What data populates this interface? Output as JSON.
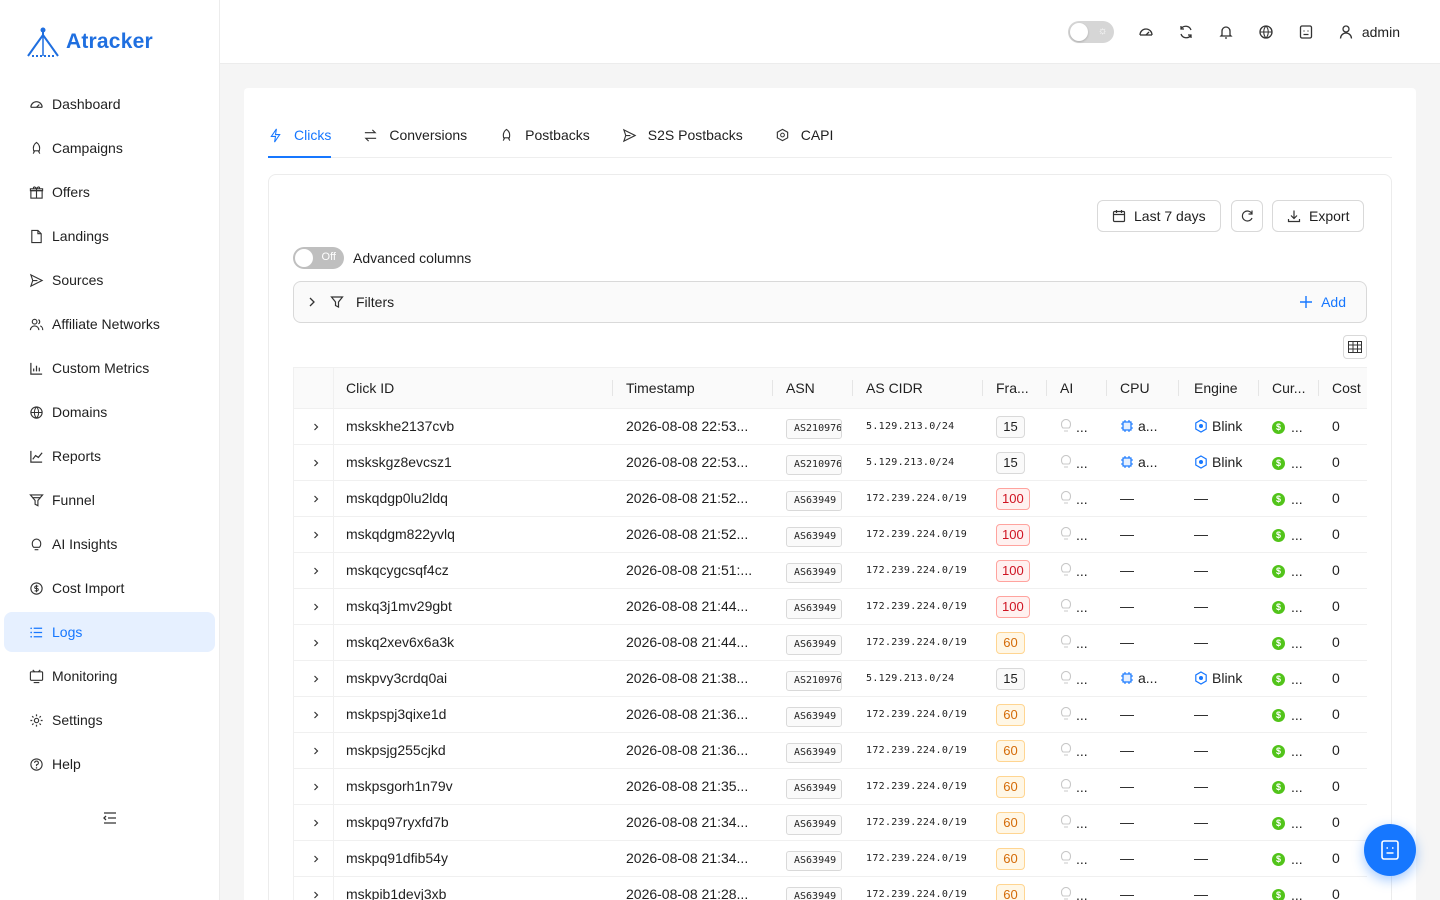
{
  "app": {
    "brand": "Atracker",
    "accent": "#1677ff"
  },
  "sidebar": {
    "items": [
      {
        "label": "Dashboard",
        "icon": "dashboard-icon"
      },
      {
        "label": "Campaigns",
        "icon": "rocket-icon"
      },
      {
        "label": "Offers",
        "icon": "gift-icon"
      },
      {
        "label": "Landings",
        "icon": "file-icon"
      },
      {
        "label": "Sources",
        "icon": "send-icon"
      },
      {
        "label": "Affiliate Networks",
        "icon": "users-icon"
      },
      {
        "label": "Custom Metrics",
        "icon": "bar-chart-icon"
      },
      {
        "label": "Domains",
        "icon": "globe-icon"
      },
      {
        "label": "Reports",
        "icon": "line-chart-icon"
      },
      {
        "label": "Funnel",
        "icon": "funnel-icon"
      },
      {
        "label": "AI Insights",
        "icon": "bulb-icon"
      },
      {
        "label": "Cost Import",
        "icon": "dollar-icon"
      },
      {
        "label": "Logs",
        "icon": "list-icon",
        "active": true
      },
      {
        "label": "Monitoring",
        "icon": "monitor-icon"
      },
      {
        "label": "Settings",
        "icon": "gear-icon"
      },
      {
        "label": "Help",
        "icon": "help-icon"
      }
    ]
  },
  "header": {
    "user": "admin"
  },
  "tabs": [
    {
      "label": "Clicks",
      "icon": "thunder-icon",
      "active": true
    },
    {
      "label": "Conversions",
      "icon": "swap-icon"
    },
    {
      "label": "Postbacks",
      "icon": "rocket-icon"
    },
    {
      "label": "S2S Postbacks",
      "icon": "send-icon"
    },
    {
      "label": "CAPI",
      "icon": "api-icon"
    }
  ],
  "toolbar": {
    "date_range": "Last 7 days",
    "export": "Export"
  },
  "advanced": {
    "switch_text": "Off",
    "label": "Advanced columns"
  },
  "filters": {
    "label": "Filters",
    "add": "Add"
  },
  "table": {
    "columns": [
      "Click ID",
      "Timestamp",
      "ASN",
      "AS CIDR",
      "Fra...",
      "AI",
      "CPU",
      "Engine",
      "Cur...",
      "Cost"
    ],
    "rows": [
      {
        "id": "mskskhe2137cvb",
        "ts": "2026-08-08 22:53...",
        "asn": "AS210976",
        "cidr": "5.129.213.0/24",
        "fraud": "15",
        "level": "low",
        "cpu": "a...",
        "engine": "Blink",
        "cost": "0"
      },
      {
        "id": "mskskgz8evcsz1",
        "ts": "2026-08-08 22:53...",
        "asn": "AS210976",
        "cidr": "5.129.213.0/24",
        "fraud": "15",
        "level": "low",
        "cpu": "a...",
        "engine": "Blink",
        "cost": "0"
      },
      {
        "id": "mskqdgp0lu2ldq",
        "ts": "2026-08-08 21:52...",
        "asn": "AS63949",
        "cidr": "172.239.224.0/19",
        "fraud": "100",
        "level": "high",
        "cpu": "—",
        "engine": "—",
        "cost": "0"
      },
      {
        "id": "mskqdgm822yvlq",
        "ts": "2026-08-08 21:52...",
        "asn": "AS63949",
        "cidr": "172.239.224.0/19",
        "fraud": "100",
        "level": "high",
        "cpu": "—",
        "engine": "—",
        "cost": "0"
      },
      {
        "id": "mskqcygcsqf4cz",
        "ts": "2026-08-08 21:51:...",
        "asn": "AS63949",
        "cidr": "172.239.224.0/19",
        "fraud": "100",
        "level": "high",
        "cpu": "—",
        "engine": "—",
        "cost": "0"
      },
      {
        "id": "mskq3j1mv29gbt",
        "ts": "2026-08-08 21:44...",
        "asn": "AS63949",
        "cidr": "172.239.224.0/19",
        "fraud": "100",
        "level": "high",
        "cpu": "—",
        "engine": "—",
        "cost": "0"
      },
      {
        "id": "mskq2xev6x6a3k",
        "ts": "2026-08-08 21:44...",
        "asn": "AS63949",
        "cidr": "172.239.224.0/19",
        "fraud": "60",
        "level": "mid",
        "cpu": "—",
        "engine": "—",
        "cost": "0"
      },
      {
        "id": "mskpvy3crdq0ai",
        "ts": "2026-08-08 21:38...",
        "asn": "AS210976",
        "cidr": "5.129.213.0/24",
        "fraud": "15",
        "level": "low",
        "cpu": "a...",
        "engine": "Blink",
        "cost": "0"
      },
      {
        "id": "mskpspj3qixe1d",
        "ts": "2026-08-08 21:36...",
        "asn": "AS63949",
        "cidr": "172.239.224.0/19",
        "fraud": "60",
        "level": "mid",
        "cpu": "—",
        "engine": "—",
        "cost": "0"
      },
      {
        "id": "mskpsjg255cjkd",
        "ts": "2026-08-08 21:36...",
        "asn": "AS63949",
        "cidr": "172.239.224.0/19",
        "fraud": "60",
        "level": "mid",
        "cpu": "—",
        "engine": "—",
        "cost": "0"
      },
      {
        "id": "mskpsgorh1n79v",
        "ts": "2026-08-08 21:35...",
        "asn": "AS63949",
        "cidr": "172.239.224.0/19",
        "fraud": "60",
        "level": "mid",
        "cpu": "—",
        "engine": "—",
        "cost": "0"
      },
      {
        "id": "mskpq97ryxfd7b",
        "ts": "2026-08-08 21:34...",
        "asn": "AS63949",
        "cidr": "172.239.224.0/19",
        "fraud": "60",
        "level": "mid",
        "cpu": "—",
        "engine": "—",
        "cost": "0"
      },
      {
        "id": "mskpq91dfib54y",
        "ts": "2026-08-08 21:34...",
        "asn": "AS63949",
        "cidr": "172.239.224.0/19",
        "fraud": "60",
        "level": "mid",
        "cpu": "—",
        "engine": "—",
        "cost": "0"
      },
      {
        "id": "mskpib1devj3xb",
        "ts": "2026-08-08 21:28...",
        "asn": "AS63949",
        "cidr": "172.239.224.0/19",
        "fraud": "60",
        "level": "mid",
        "cpu": "—",
        "engine": "—",
        "cost": "0"
      }
    ]
  }
}
